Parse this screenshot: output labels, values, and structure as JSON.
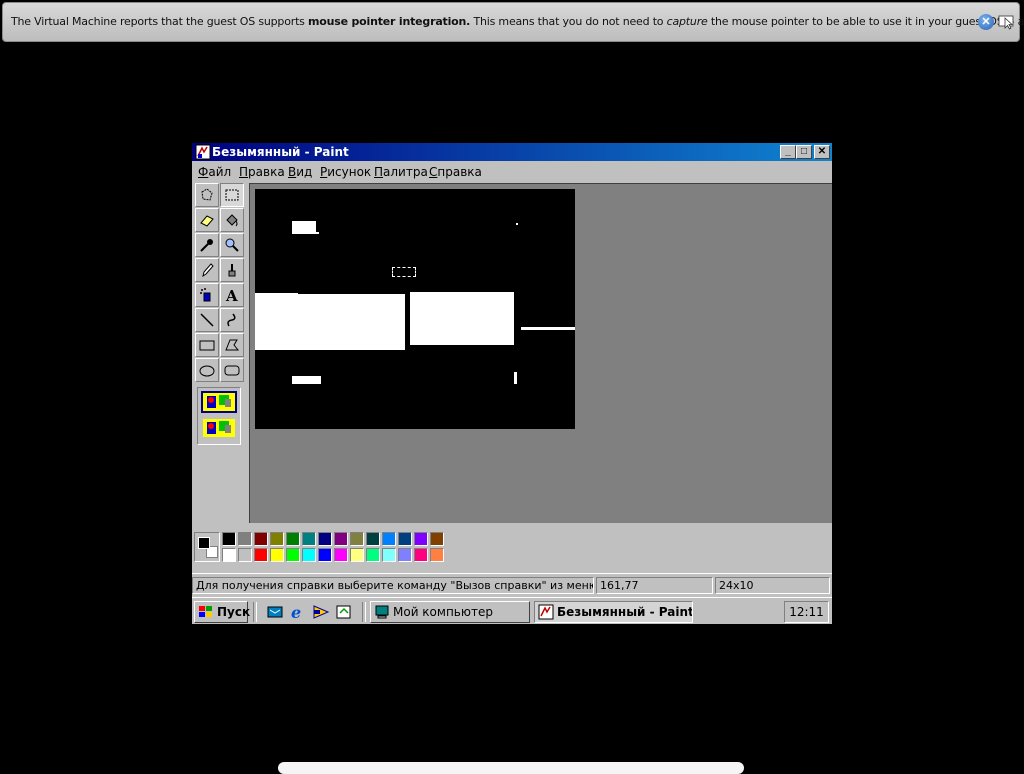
{
  "vm_banner": {
    "text_before": "The Virtual Machine reports that the guest OS supports ",
    "bold": "mouse pointer integration.",
    "text_middle": " This means that you do not need to ",
    "italic": "capture",
    "text_after": " the mouse pointer to be able to use it in your guest OS -- all mouse",
    "close_icon": "close-icon",
    "mouse_icon": "mouse-integration-icon"
  },
  "window": {
    "title": "Безымянный - Paint",
    "buttons": {
      "minimize": "_",
      "maximize": "□",
      "close": "✕"
    }
  },
  "menu": [
    "Файл",
    "Правка",
    "Вид",
    "Рисунок",
    "Палитра",
    "Справка"
  ],
  "tools": [
    {
      "name": "free-select",
      "icon": "free-select-icon"
    },
    {
      "name": "rect-select",
      "icon": "rect-select-icon"
    },
    {
      "name": "eraser",
      "icon": "eraser-icon"
    },
    {
      "name": "fill",
      "icon": "fill-bucket-icon"
    },
    {
      "name": "pick-color",
      "icon": "eyedropper-icon"
    },
    {
      "name": "magnifier",
      "icon": "magnifier-icon"
    },
    {
      "name": "pencil",
      "icon": "pencil-icon"
    },
    {
      "name": "brush",
      "icon": "brush-icon"
    },
    {
      "name": "airbrush",
      "icon": "airbrush-icon"
    },
    {
      "name": "text",
      "icon": "text-icon",
      "glyph": "A"
    },
    {
      "name": "line",
      "icon": "line-icon"
    },
    {
      "name": "curve",
      "icon": "curve-icon"
    },
    {
      "name": "rectangle",
      "icon": "rectangle-icon"
    },
    {
      "name": "polygon",
      "icon": "polygon-icon"
    },
    {
      "name": "ellipse",
      "icon": "ellipse-icon"
    },
    {
      "name": "rounded-rectangle",
      "icon": "rounded-rect-icon"
    }
  ],
  "selected_tool": "rect-select",
  "palette": {
    "foreground": "#000000",
    "background": "#ffffff",
    "top_row": [
      "#000000",
      "#808080",
      "#800000",
      "#808000",
      "#008000",
      "#008080",
      "#000080",
      "#800080",
      "#808040",
      "#004040",
      "#0080ff",
      "#004080",
      "#8000ff",
      "#804000"
    ],
    "bottom_row": [
      "#ffffff",
      "#c0c0c0",
      "#ff0000",
      "#ffff00",
      "#00ff00",
      "#00ffff",
      "#0000ff",
      "#ff00ff",
      "#ffff80",
      "#00ff80",
      "#80ffff",
      "#8080ff",
      "#ff0080",
      "#ff8040"
    ]
  },
  "status": {
    "help": "Для получения справки выберите команду \"Вызов справки\" из меню \"Справка\".",
    "coords": "161,77",
    "size": "24x10"
  },
  "taskbar": {
    "start": "Пуск",
    "quick_launch": [
      "show-desktop-icon",
      "internet-explorer-icon",
      "outlook-express-icon",
      "channels-icon"
    ],
    "tasks": [
      {
        "label": "Мой компьютер",
        "active": false
      },
      {
        "label": "Безымянный - Paint",
        "active": true
      }
    ],
    "clock": "12:11"
  }
}
